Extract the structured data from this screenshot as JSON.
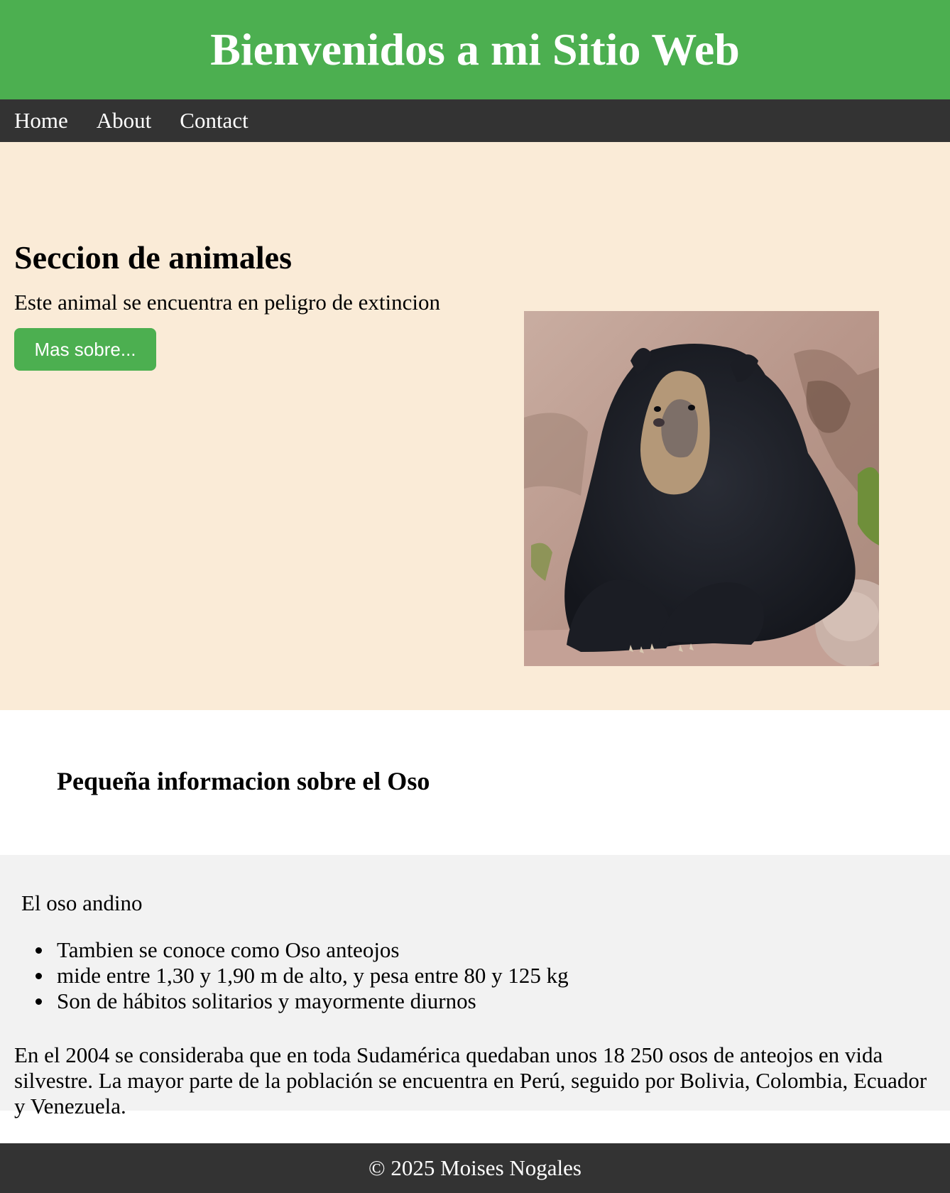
{
  "header": {
    "title": "Bienvenidos a mi Sitio Web",
    "bg_color": "#4caf50"
  },
  "nav": {
    "items": [
      {
        "label": "Home"
      },
      {
        "label": "About"
      },
      {
        "label": "Contact"
      }
    ],
    "bg_color": "#333333"
  },
  "hero": {
    "title": "Seccion de animales",
    "subtitle": "Este animal se encuentra en peligro de extincion",
    "button_label": "Mas sobre...",
    "bg_color": "#faebd7",
    "image": "spectacled-bear-photo"
  },
  "info": {
    "title": "Pequeña informacion sobre el Oso"
  },
  "facts": {
    "lead": "El oso andino",
    "items": [
      "Tambien se conoce como Oso anteojos",
      "mide entre 1,30 y 1,90 m de alto, y pesa entre 80 y 125 kg",
      "Son de hábitos solitarios y mayormente diurnos"
    ],
    "paragraph": "En el 2004 se consideraba que en toda Sudamérica quedaban unos 18 250 osos de anteojos en vida silvestre. La mayor parte de la población se encuentra en Perú, seguido por Bolivia, Colombia, Ecuador y Venezuela.",
    "bg_color": "#f2f2f2"
  },
  "footer": {
    "text": "© 2025 Moises Nogales"
  }
}
